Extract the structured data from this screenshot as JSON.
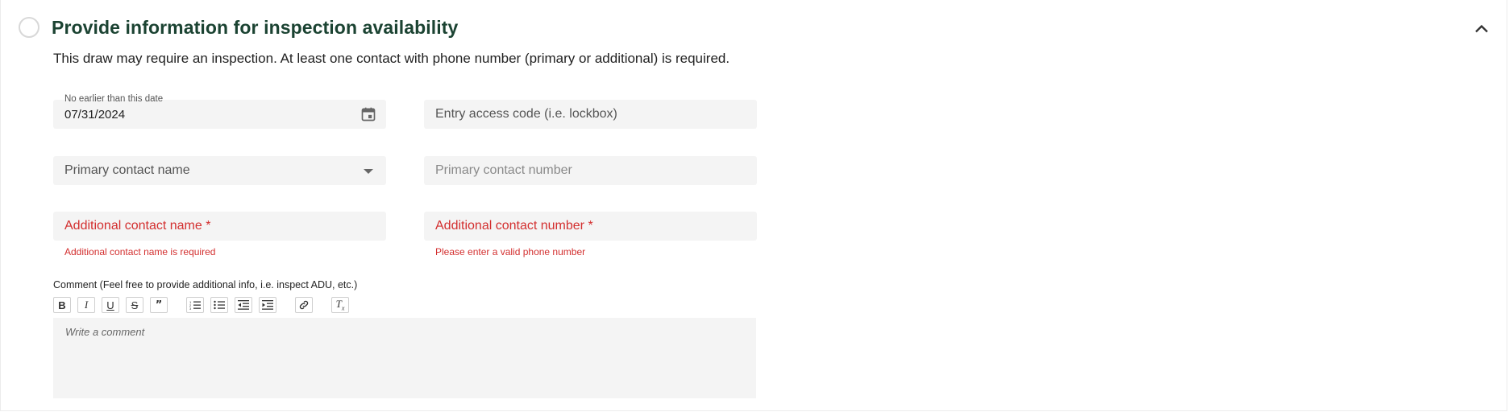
{
  "section": {
    "title": "Provide information for inspection availability",
    "description": "This draw may require an inspection. At least one contact with phone number (primary or additional) is required."
  },
  "fields": {
    "date": {
      "label": "No earlier than this date",
      "value": "07/31/2024"
    },
    "access_code": {
      "placeholder": "Entry access code (i.e. lockbox)"
    },
    "primary_name": {
      "placeholder": "Primary contact name"
    },
    "primary_number": {
      "placeholder": "Primary contact number"
    },
    "additional_name": {
      "placeholder": "Additional contact name *",
      "error": "Additional contact name is required"
    },
    "additional_number": {
      "placeholder": "Additional contact number *",
      "error": "Please enter a valid phone number"
    }
  },
  "comment": {
    "label": "Comment (Feel free to provide additional info, i.e. inspect ADU, etc.)",
    "placeholder": "Write a comment",
    "toolbar": [
      "bold-icon",
      "italic-icon",
      "underline-icon",
      "strikethrough-icon",
      "quote-icon",
      "ordered-list-icon",
      "bullet-list-icon",
      "outdent-icon",
      "indent-icon",
      "link-icon",
      "clear-format-icon"
    ]
  },
  "colors": {
    "title": "#1b4332",
    "error": "#d32f2f",
    "field_bg": "#f4f4f4"
  }
}
